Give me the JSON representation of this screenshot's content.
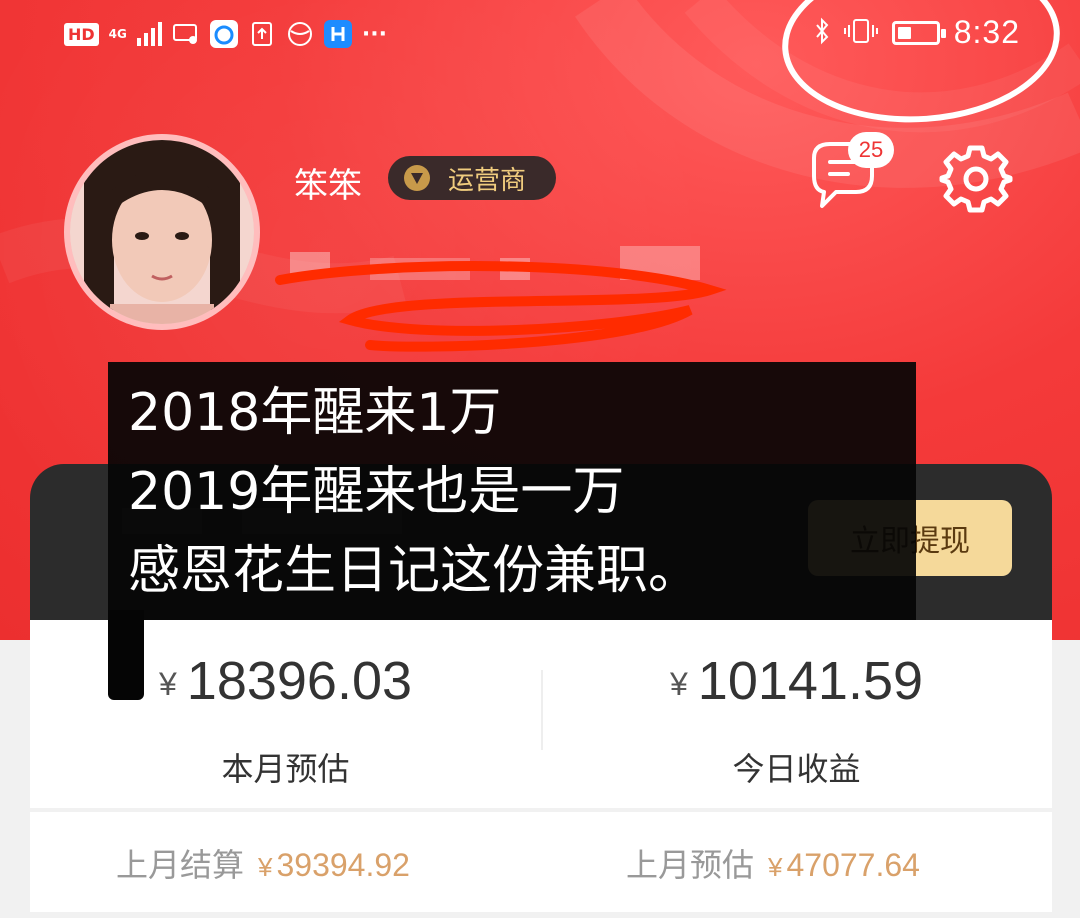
{
  "status_bar": {
    "hd": "HD",
    "network": "4G",
    "more": "···",
    "time": "8:32",
    "battery_level": 0.35
  },
  "profile": {
    "username": "笨笨",
    "role_badge": "运营商",
    "message_count": "25"
  },
  "wallet": {
    "withdraw_button": "立即提现"
  },
  "earnings": {
    "currency_symbol": "¥",
    "month_estimate_value": "18396.03",
    "month_estimate_label": "本月预估",
    "today_income_value": "10141.59",
    "today_income_label": "今日收益"
  },
  "settlement": {
    "last_month_settled_label": "上月结算",
    "last_month_settled_value": "39394.92",
    "last_month_estimate_label": "上月预估",
    "last_month_estimate_value": "47077.64"
  },
  "caption": {
    "line1": "2018年醒来1万",
    "line2": "2019年醒来也是一万",
    "line3": "感恩花生日记这份兼职。"
  },
  "colors": {
    "brand_red": "#ec2f2f",
    "withdraw_gold": "#f5d99a",
    "settle_value": "#d9a16a"
  }
}
